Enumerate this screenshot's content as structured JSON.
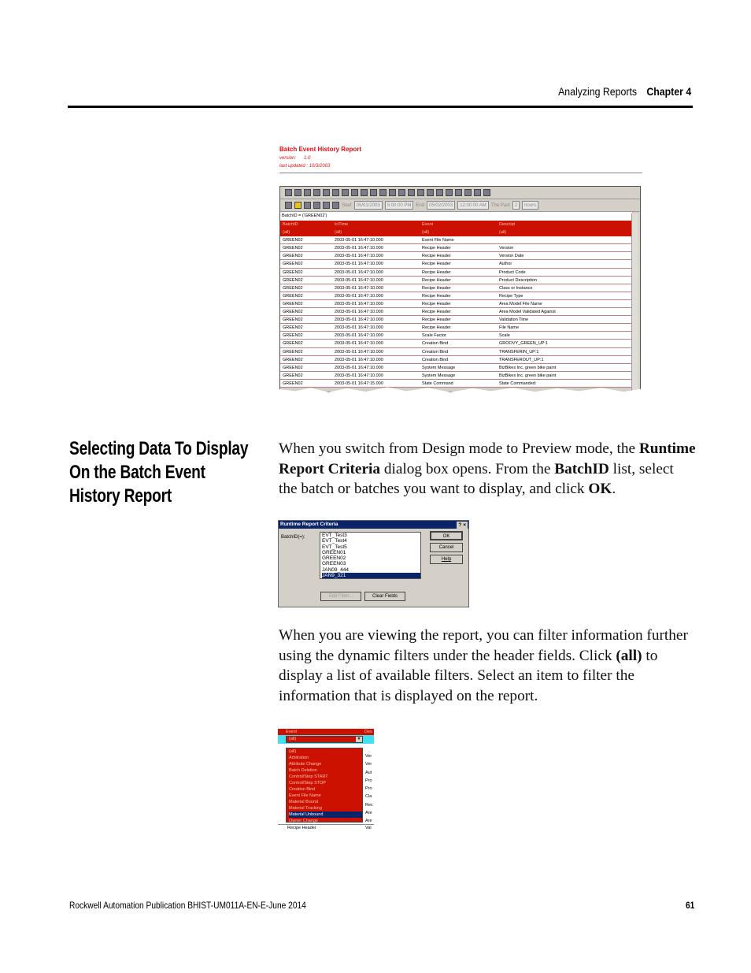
{
  "header": {
    "section": "Analyzing Reports",
    "chapter": "Chapter 4"
  },
  "report": {
    "title": "Batch Event History Report",
    "version_label": "version:",
    "version": "1.0",
    "updated_label": "last updated :",
    "updated": "10/3/2003",
    "toolbar": {
      "start_label": "Start",
      "start_date": "05/01/2003",
      "start_time": "5:00:00 PM",
      "end_label": "End",
      "end_date": "05/02/2003",
      "end_time": "12:00:00 AM",
      "past_label": "The Past",
      "past_value": "2",
      "past_unit": "hours"
    },
    "filter": "BatchID = ('GREEN02')",
    "columns": [
      "BatchID",
      "lclTime",
      "Event",
      "Descript"
    ],
    "filters": [
      "(all)",
      "(all)",
      "(all)",
      "(all)"
    ],
    "rows": [
      [
        "GREEN02",
        "2003-05-01 16:47:10.000",
        "Event File Name",
        ""
      ],
      [
        "GREEN02",
        "2003-05-01 16:47:10.000",
        "Recipe Header",
        "Version"
      ],
      [
        "GREEN02",
        "2003-05-01 16:47:10.000",
        "Recipe Header",
        "Version Date"
      ],
      [
        "GREEN02",
        "2003-05-01 16:47:10.000",
        "Recipe Header",
        "Author"
      ],
      [
        "GREEN02",
        "2003-05-01 16:47:10.000",
        "Recipe Header",
        "Product Code"
      ],
      [
        "GREEN02",
        "2003-05-01 16:47:10.000",
        "Recipe Header",
        "Product Description"
      ],
      [
        "GREEN02",
        "2003-05-01 16:47:10.000",
        "Recipe Header",
        "Class or Instance"
      ],
      [
        "GREEN02",
        "2003-05-01 16:47:10.000",
        "Recipe Header",
        "Recipe Type"
      ],
      [
        "GREEN02",
        "2003-05-01 16:47:10.000",
        "Recipe Header",
        "Area Model File Name"
      ],
      [
        "GREEN02",
        "2003-05-01 16:47:10.000",
        "Recipe Header",
        "Area Model Validated Against"
      ],
      [
        "GREEN02",
        "2003-05-01 16:47:10.000",
        "Recipe Header",
        "Validation Time"
      ],
      [
        "GREEN02",
        "2003-05-01 16:47:10.000",
        "Recipe Header",
        "File Name"
      ],
      [
        "GREEN02",
        "2003-05-01 16:47:10.000",
        "Scale Factor",
        "Scale"
      ],
      [
        "GREEN02",
        "2003-05-01 16:47:10.000",
        "Creation Bind",
        "GROOVY_GREEN_UP:1"
      ],
      [
        "GREEN02",
        "2003-05-01 16:47:10.000",
        "Creation Bind",
        "TRANSFERIN_UP:1"
      ],
      [
        "GREEN02",
        "2003-05-01 16:47:10.000",
        "Creation Bind",
        "TRANSFEROUT_UP:1"
      ],
      [
        "GREEN02",
        "2003-05-01 16:47:10.000",
        "System Message",
        "BizBikes Inc. green bike paint"
      ],
      [
        "GREEN02",
        "2003-05-01 16:47:10.000",
        "System Message",
        "BizBikes Inc. green bike paint"
      ],
      [
        "GREEN02",
        "2003-05-01 16:47:15.000",
        "State Command",
        "State Commanded:"
      ]
    ]
  },
  "section_heading": "Selecting Data To Display On the Batch Event History Report",
  "para1": [
    "When you switch from Design mode to Preview mode, the ",
    "Runtime Report Criteria",
    " dialog box opens. From the ",
    "BatchID",
    " list, select the batch or batches you want to display, and click ",
    "OK",
    "."
  ],
  "dialog": {
    "title": "Runtime Report Criteria",
    "field_label": "BatchID(=):",
    "items": [
      "EVT_Test3",
      "EVT_Test4",
      "EVT_Test5",
      "GREEN01",
      "GREEN02",
      "GREEN03",
      "JAN09_444",
      "JAN9_321"
    ],
    "selected": "JAN9_321",
    "ok": "OK",
    "cancel": "Cancel",
    "help": "Help",
    "edit_filter": "Edit Filter...",
    "clear_fields": "Clear Fields"
  },
  "para2": [
    "When you are viewing the report, you can filter information further using the dynamic filters under the header fields. Click ",
    "(all)",
    " to display a list of available filters. Select an item to filter the information that is displayed on the report."
  ],
  "dropdown": {
    "column": "Event",
    "next_column": "Des",
    "value": "(all)",
    "items": [
      "(all)",
      "Arbitration",
      "Attribute Change",
      "Batch Deletion",
      "Control/Step START",
      "Control/Step STOP",
      "Creation Bind",
      "Event File Name",
      "Material Bound",
      "Material Tracking",
      "Material Unbound",
      "Owner Change"
    ],
    "selected": "Material Unbound",
    "side": [
      "Ver",
      "Ver",
      "Aut",
      "Pro",
      "Pro",
      "Cla",
      "Rec",
      "Are",
      "Are"
    ],
    "below": "Recipe Header",
    "below_side": "Val"
  },
  "footer": {
    "publication": "Rockwell Automation Publication BHIST-UM011A-EN-E-June 2014",
    "page": "61"
  },
  "colors": {
    "report_red": "#cc1100",
    "title_red": "#e01010",
    "selection": "#0a246a"
  }
}
